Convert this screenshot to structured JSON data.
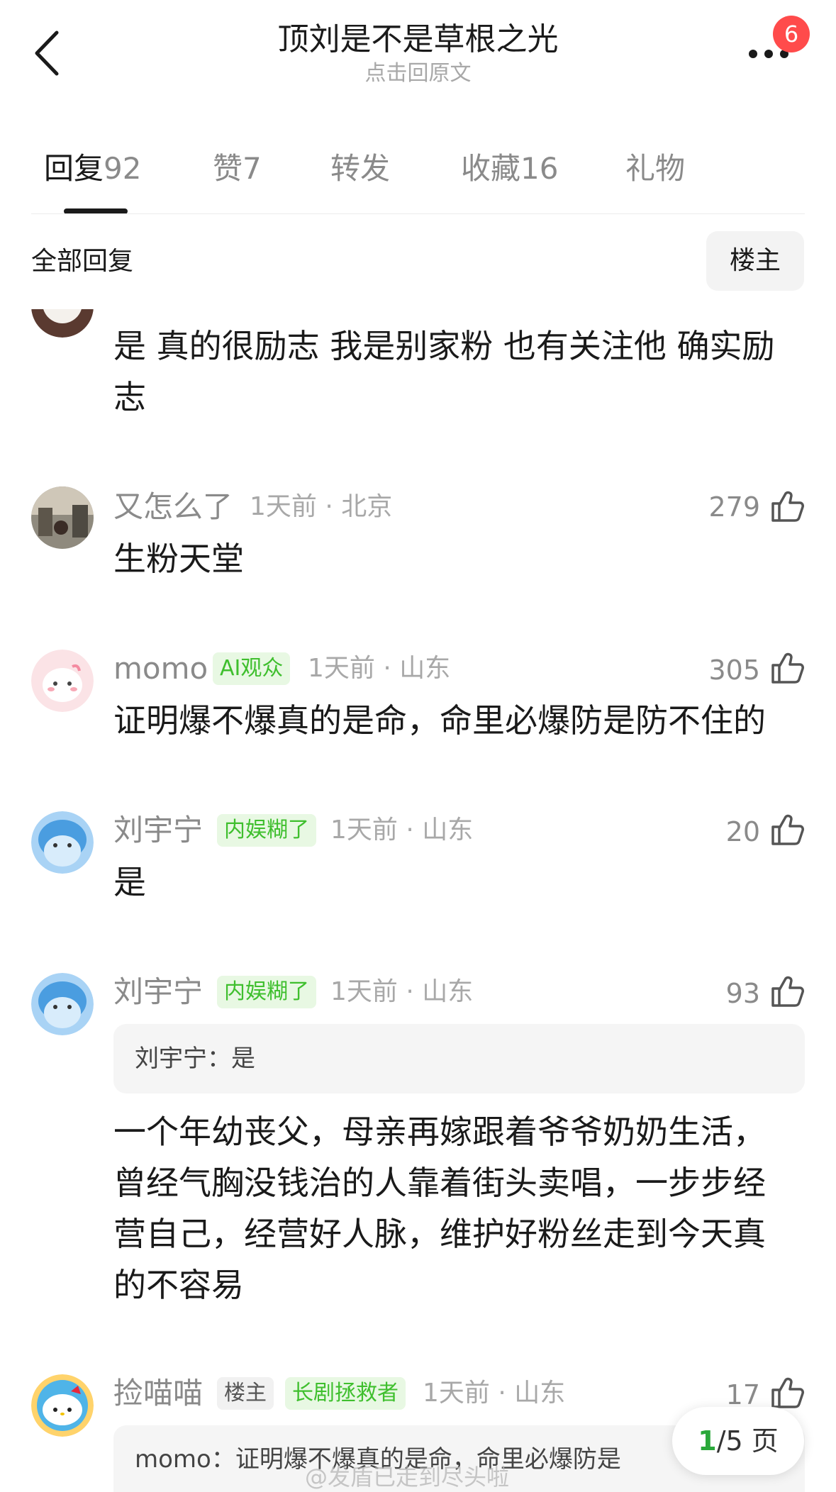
{
  "header": {
    "title": "顶刘是不是草根之光",
    "subtitle": "点击回原文",
    "more_badge": "6"
  },
  "tabs": [
    {
      "label": "回复",
      "count": "92"
    },
    {
      "label": "赞",
      "count": "7"
    },
    {
      "label": "转发",
      "count": ""
    },
    {
      "label": "收藏",
      "count": "16"
    },
    {
      "label": "礼物",
      "count": ""
    }
  ],
  "filter": {
    "all_label": "全部回复",
    "op_label": "楼主"
  },
  "comments": [
    {
      "text_line1": "是 真的很励志 我是别家粉 也有关注他 确实励",
      "text_line2": "志"
    },
    {
      "name": "又怎么了",
      "meta": "1天前 · 北京",
      "likes": "279",
      "text": "生粉天堂"
    },
    {
      "name": "momo",
      "badge": "AI观众",
      "meta": "1天前 · 山东",
      "likes": "305",
      "text": "证明爆不爆真的是命，命里必爆防是防不住的"
    },
    {
      "name": "刘宇宁",
      "badge": "内娱糊了",
      "meta": "1天前 · 山东",
      "likes": "20",
      "text": "是"
    },
    {
      "name": "刘宇宁",
      "badge": "内娱糊了",
      "meta": "1天前 · 山东",
      "likes": "93",
      "quote": "刘宇宁：是",
      "lines": [
        "一个年幼丧父，母亲再嫁跟着爷爷奶奶生活，",
        "曾经气胸没钱治的人靠着街头卖唱，一步步经",
        "营自己，经营好人脉，维护好粉丝走到今天真",
        "的不容易"
      ]
    },
    {
      "name": "捡喵喵",
      "badge_op": "楼主",
      "badge": "长剧拯救者",
      "meta": "1天前 · 山东",
      "likes": "17",
      "quote": "momo：证明爆不爆真的是命，命里必爆防是"
    }
  ],
  "pager": {
    "current": "1",
    "total_text": "/5 页"
  },
  "watermark": "@发盾已走到尽头啦",
  "colors": {
    "accent_green": "#3fbf2e",
    "badge_red": "#ff4b4b"
  }
}
